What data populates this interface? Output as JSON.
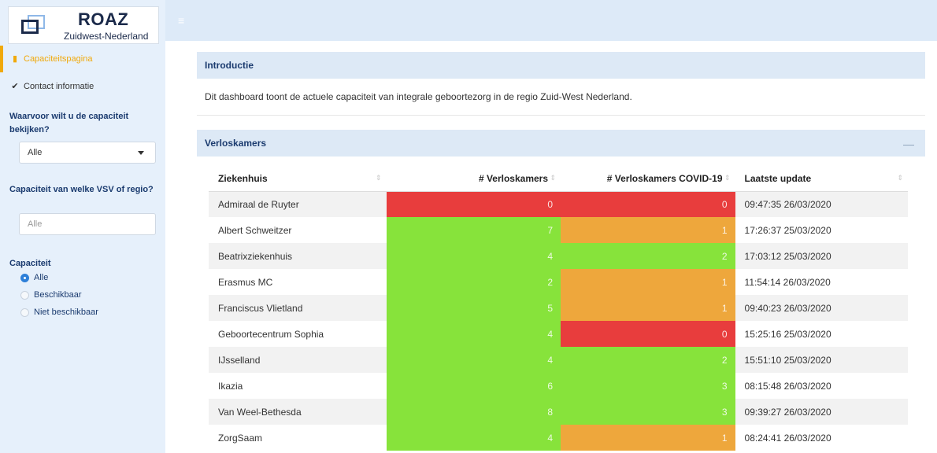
{
  "brand": {
    "title": "ROAZ",
    "subtitle": "Zuidwest-Nederland"
  },
  "sidebar": {
    "nav": [
      {
        "label": "Capaciteitspagina",
        "icon": "bookmark-icon",
        "active": true
      },
      {
        "label": "Contact informatie",
        "icon": "check-double-icon",
        "active": false
      }
    ],
    "capacity_for_label": "Waarvoor wilt u de capaciteit bekijken?",
    "capacity_for_value": "Alle",
    "region_label": "Capaciteit van welke VSV of regio?",
    "region_placeholder": "Alle",
    "capacity_label": "Capaciteit",
    "capacity_options": [
      {
        "label": "Alle",
        "checked": true
      },
      {
        "label": "Beschikbaar",
        "checked": false
      },
      {
        "label": "Niet beschikbaar",
        "checked": false
      }
    ]
  },
  "intro": {
    "title": "Introductie",
    "text": "Dit dashboard toont de actuele capaciteit van integrale geboortezorg in de regio Zuid-West Nederland."
  },
  "verloskamers": {
    "title": "Verloskamers",
    "collapse_icon": "minus-icon",
    "columns": [
      "Ziekenhuis",
      "# Verloskamers",
      "# Verloskamers COVID-19",
      "Laatste update"
    ],
    "colors": {
      "green": "#87e33b",
      "orange": "#eea73c",
      "red": "#e83d3d"
    },
    "rows": [
      {
        "name": "Admiraal de Ruyter",
        "verloskamers": "0",
        "v_status": "red",
        "covid": "0",
        "c_status": "red",
        "update": "09:47:35 26/03/2020"
      },
      {
        "name": "Albert Schweitzer",
        "verloskamers": "7",
        "v_status": "green",
        "covid": "1",
        "c_status": "orange",
        "update": "17:26:37 25/03/2020"
      },
      {
        "name": "Beatrixziekenhuis",
        "verloskamers": "4",
        "v_status": "green",
        "covid": "2",
        "c_status": "green",
        "update": "17:03:12 25/03/2020"
      },
      {
        "name": "Erasmus MC",
        "verloskamers": "2",
        "v_status": "green",
        "covid": "1",
        "c_status": "orange",
        "update": "11:54:14 26/03/2020"
      },
      {
        "name": "Franciscus Vlietland",
        "verloskamers": "5",
        "v_status": "green",
        "covid": "1",
        "c_status": "orange",
        "update": "09:40:23 26/03/2020"
      },
      {
        "name": "Geboortecentrum Sophia",
        "verloskamers": "4",
        "v_status": "green",
        "covid": "0",
        "c_status": "red",
        "update": "15:25:16 25/03/2020"
      },
      {
        "name": "IJsselland",
        "verloskamers": "4",
        "v_status": "green",
        "covid": "2",
        "c_status": "green",
        "update": "15:51:10 25/03/2020"
      },
      {
        "name": "Ikazia",
        "verloskamers": "6",
        "v_status": "green",
        "covid": "3",
        "c_status": "green",
        "update": "08:15:48 26/03/2020"
      },
      {
        "name": "Van Weel-Bethesda",
        "verloskamers": "8",
        "v_status": "green",
        "covid": "3",
        "c_status": "green",
        "update": "09:39:27 26/03/2020"
      },
      {
        "name": "ZorgSaam",
        "verloskamers": "4",
        "v_status": "green",
        "covid": "1",
        "c_status": "orange",
        "update": "08:24:41 26/03/2020"
      }
    ]
  }
}
